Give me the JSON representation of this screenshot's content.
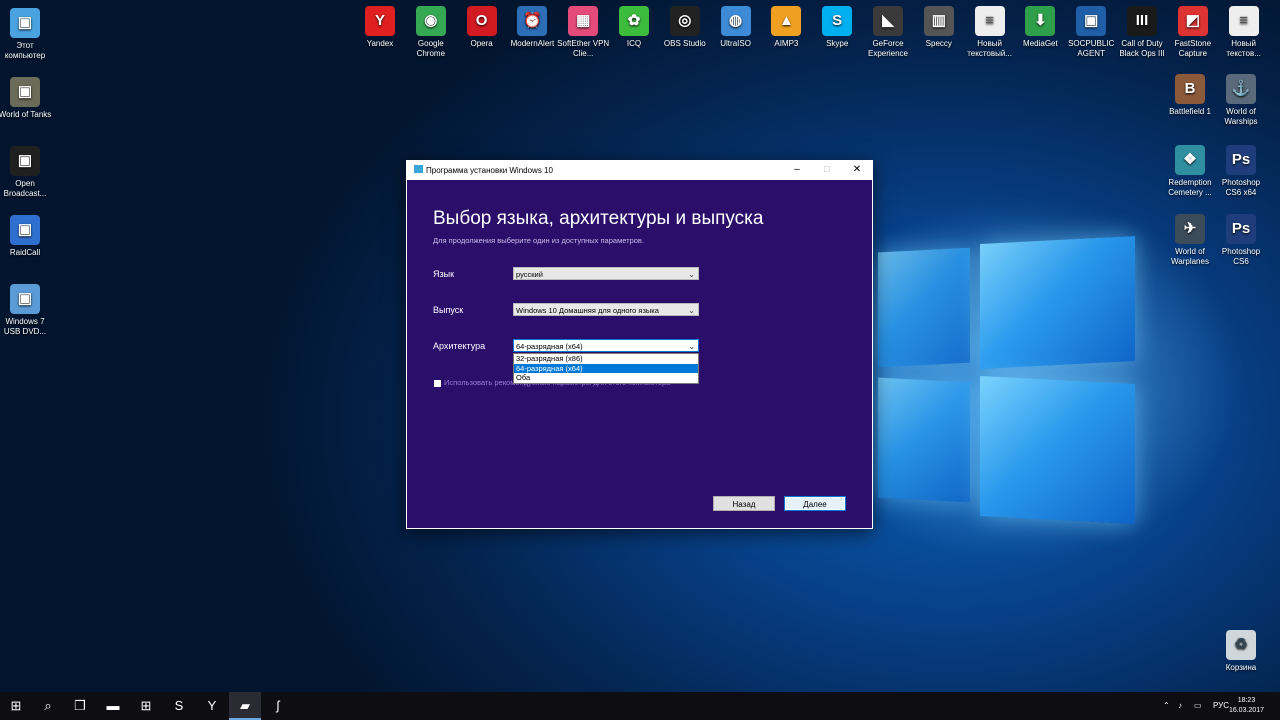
{
  "desktop": {
    "left_icons": [
      {
        "label": "Этот компьютер",
        "icon": "computer-icon",
        "color": "#4aa3e0"
      },
      {
        "label": "World of Tanks",
        "icon": "wot-icon",
        "color": "#6b6b5a"
      },
      {
        "label": "Open Broadcast...",
        "icon": "obs-icon",
        "color": "#202020"
      },
      {
        "label": "RaidCall",
        "icon": "raidcall-icon",
        "color": "#2f6fd0"
      },
      {
        "label": "Windows 7 USB DVD...",
        "icon": "usb-dvd-icon",
        "color": "#5b9bd5"
      }
    ],
    "top_icons": [
      {
        "label": "Yandex",
        "icon": "yandex-icon",
        "color": "#e02020",
        "glyph": "Y"
      },
      {
        "label": "Google Chrome",
        "icon": "chrome-icon",
        "color": "#34a853",
        "glyph": "◉"
      },
      {
        "label": "Opera",
        "icon": "opera-icon",
        "color": "#d21a22",
        "glyph": "O"
      },
      {
        "label": "ModernAlert",
        "icon": "alarm-clock-icon",
        "color": "#2c6fb7",
        "glyph": "⏰"
      },
      {
        "label": "SoftEther VPN Clie...",
        "icon": "vpn-icon",
        "color": "#e54b7a",
        "glyph": "▦"
      },
      {
        "label": "ICQ",
        "icon": "icq-icon",
        "color": "#3cbb3c",
        "glyph": "✿"
      },
      {
        "label": "OBS Studio",
        "icon": "obs-studio-icon",
        "color": "#222",
        "glyph": "◎"
      },
      {
        "label": "UltraISO",
        "icon": "ultraiso-icon",
        "color": "#3d8ad6",
        "glyph": "◍"
      },
      {
        "label": "AIMP3",
        "icon": "aimp-icon",
        "color": "#f0a020",
        "glyph": "▲"
      },
      {
        "label": "Skype",
        "icon": "skype-icon",
        "color": "#00aff0",
        "glyph": "S"
      },
      {
        "label": "GeForce Experience",
        "icon": "geforce-icon",
        "color": "#3a3a3a",
        "glyph": "◣"
      },
      {
        "label": "Speccy",
        "icon": "speccy-icon",
        "color": "#555",
        "glyph": "▥"
      },
      {
        "label": "Новый текстовый...",
        "icon": "text-document-icon",
        "color": "#eeeeee",
        "glyph": "≡"
      },
      {
        "label": "MediaGet",
        "icon": "mediaget-icon",
        "color": "#2e9f4a",
        "glyph": "⬇"
      },
      {
        "label": "SOCPUBLIC AGENT",
        "icon": "socpublic-icon",
        "color": "#1f5fa8",
        "glyph": "▣"
      },
      {
        "label": "Call of Duty Black Ops III",
        "icon": "cod-icon",
        "color": "#1a1a1a",
        "glyph": "III"
      },
      {
        "label": "FastStone Capture",
        "icon": "faststone-icon",
        "color": "#d33",
        "glyph": "◩"
      },
      {
        "label": "Новый текстов...",
        "icon": "text-document-icon",
        "color": "#eeeeee",
        "glyph": "≡"
      }
    ],
    "right_icons": [
      {
        "label": "Battlefield 1",
        "icon": "battlefield-icon",
        "color": "#8a5a3a",
        "glyph": "B"
      },
      {
        "label": "World of Warships",
        "icon": "wows-icon",
        "color": "#5a6a7a",
        "glyph": "⚓"
      },
      {
        "label": "Redemption Cemetery ...",
        "icon": "redemption-icon",
        "color": "#2f8fa0",
        "glyph": "❖"
      },
      {
        "label": "Photoshop CS6 x64",
        "icon": "photoshop-icon",
        "color": "#1f3d7a",
        "glyph": "Ps"
      },
      {
        "label": "World of Warplanes",
        "icon": "wowp-icon",
        "color": "#3c4b5a",
        "glyph": "✈"
      },
      {
        "label": "Photoshop CS6",
        "icon": "photoshop-icon",
        "color": "#1f3d7a",
        "glyph": "Ps"
      }
    ],
    "recycle_bin": {
      "label": "Корзина",
      "icon": "recycle-bin-icon"
    }
  },
  "window": {
    "title": "Программа установки Windows 10",
    "minimize": "–",
    "maximize": "□",
    "close": "✕",
    "heading": "Выбор языка, архитектуры и выпуска",
    "subtext": "Для продолжения выберите один из доступных параметров.",
    "language_label": "Язык",
    "language_value": "русский",
    "edition_label": "Выпуск",
    "edition_value": "Windows 10 Домашняя для одного языка",
    "arch_label": "Архитектура",
    "arch_value": "64-разрядная (x64)",
    "arch_options": [
      "32-разрядная (x86)",
      "64-разрядная (x64)",
      "Оба"
    ],
    "arch_selected_index": 1,
    "recommended_checkbox_label": "Использовать рекомендуемые параметры для этого компьютера",
    "back_button": "Назад",
    "next_button": "Далее"
  },
  "taskbar": {
    "items": [
      {
        "icon": "start-windows-icon",
        "glyph": "⊞"
      },
      {
        "icon": "search-icon",
        "glyph": "⌕"
      },
      {
        "icon": "task-view-icon",
        "glyph": "❐"
      },
      {
        "icon": "file-explorer-icon",
        "glyph": "▬"
      },
      {
        "icon": "store-icon",
        "glyph": "⊞"
      },
      {
        "icon": "skype-icon",
        "glyph": "S"
      },
      {
        "icon": "yandex-browser-icon",
        "glyph": "Y"
      },
      {
        "icon": "windows-setup-icon",
        "glyph": "▰"
      },
      {
        "icon": "obs-icon",
        "glyph": "ʃ"
      }
    ],
    "tray_language": "РУС",
    "time": "18:23",
    "date": "16.03.2017"
  }
}
